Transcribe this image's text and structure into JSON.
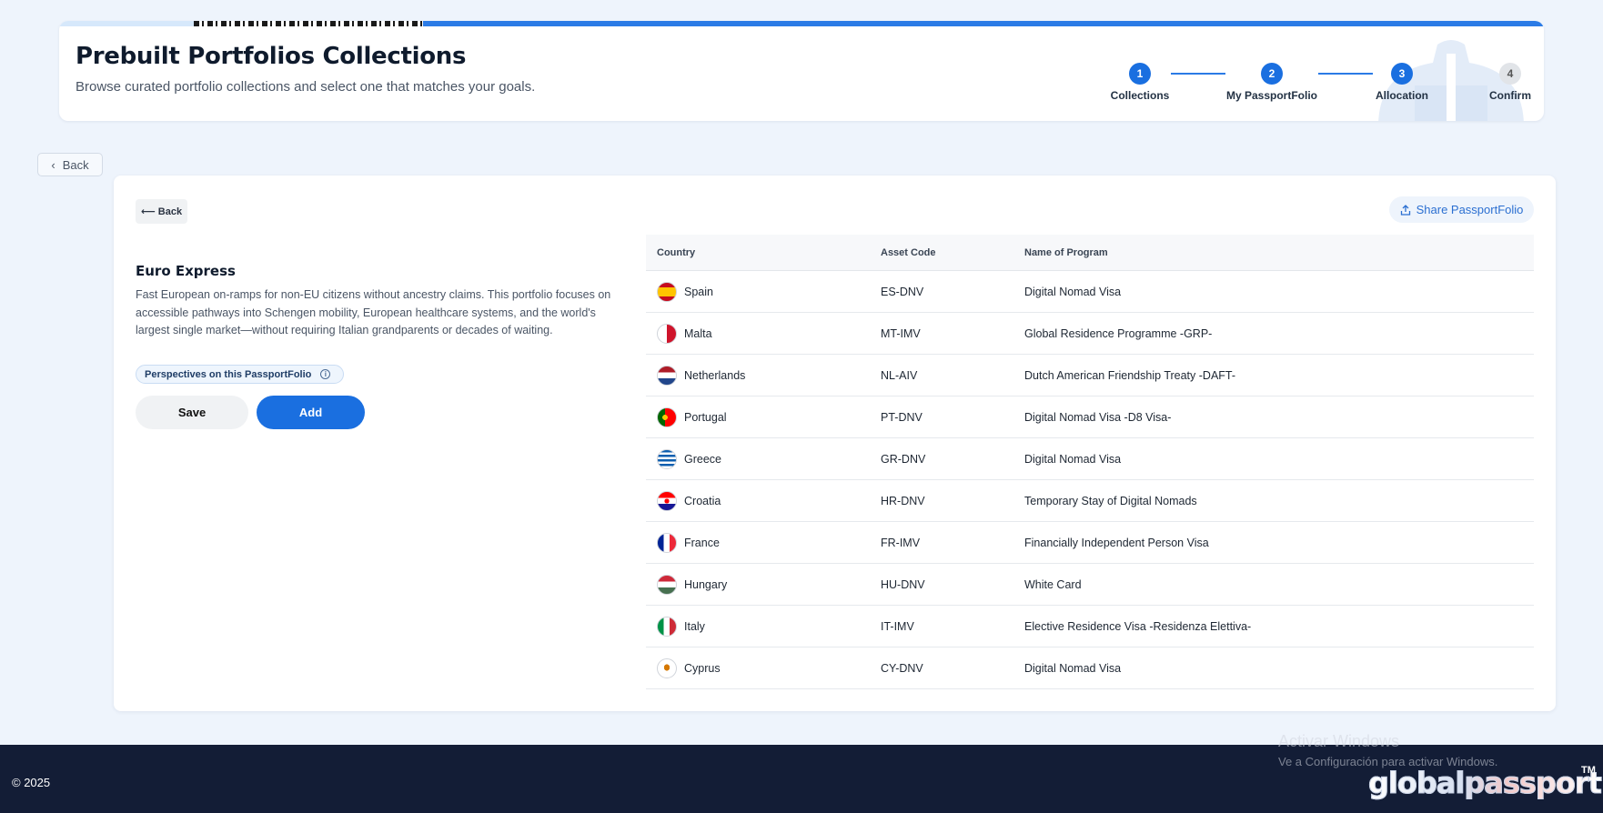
{
  "header": {
    "title": "Prebuilt Portfolios Collections",
    "subtitle": "Browse curated portfolio collections and select one that matches your goals.",
    "steps": [
      {
        "number": "1",
        "label": "Collections",
        "active": true
      },
      {
        "number": "2",
        "label": "My PassportFolio",
        "active": true
      },
      {
        "number": "3",
        "label": "Allocation",
        "active": true
      },
      {
        "number": "4",
        "label": "Confirm",
        "active": false
      }
    ]
  },
  "nav": {
    "outer_back_label": "Back",
    "outer_back_icon": "chevron-left-icon",
    "inner_back_label": "⟵ Back"
  },
  "collection": {
    "title": "Euro Express",
    "description": "Fast European on-ramps for non-EU citizens without ancestry claims. This portfolio focuses on accessible pathways into Schengen mobility, European healthcare systems, and the world's largest single market—without requiring Italian grandparents or decades of waiting.",
    "perspectives_label": "Perspectives on this PassportFolio",
    "save_label": "Save",
    "add_label": "Add",
    "share_label": "Share PassportFolio"
  },
  "table": {
    "headers": [
      "Country",
      "Asset Code",
      "Name of Program"
    ],
    "rows": [
      {
        "country": "Spain",
        "code": "ES-DNV",
        "program": "Digital Nomad Visa"
      },
      {
        "country": "Malta",
        "code": "MT-IMV",
        "program": "Global Residence Programme -GRP-"
      },
      {
        "country": "Netherlands",
        "code": "NL-AIV",
        "program": "Dutch American Friendship Treaty -DAFT-"
      },
      {
        "country": "Portugal",
        "code": "PT-DNV",
        "program": "Digital Nomad Visa -D8 Visa-"
      },
      {
        "country": "Greece",
        "code": "GR-DNV",
        "program": "Digital Nomad Visa"
      },
      {
        "country": "Croatia",
        "code": "HR-DNV",
        "program": "Temporary Stay of Digital Nomads"
      },
      {
        "country": "France",
        "code": "FR-IMV",
        "program": "Financially Independent Person Visa"
      },
      {
        "country": "Hungary",
        "code": "HU-DNV",
        "program": "White Card"
      },
      {
        "country": "Italy",
        "code": "IT-IMV",
        "program": "Elective Residence Visa -Residenza Elettiva-"
      },
      {
        "country": "Cyprus",
        "code": "CY-DNV",
        "program": "Digital Nomad Visa"
      }
    ]
  },
  "footer": {
    "copyright": "© 2025",
    "activate_title": "Activar Windows",
    "activate_sub": "Ve a Configuración para activar Windows.",
    "brand": "globalpassport",
    "brand_tm": "TM"
  },
  "colors": {
    "accent": "#1a6fe0",
    "footer_bg": "#131d36",
    "page_bg": "#eef4fc"
  }
}
